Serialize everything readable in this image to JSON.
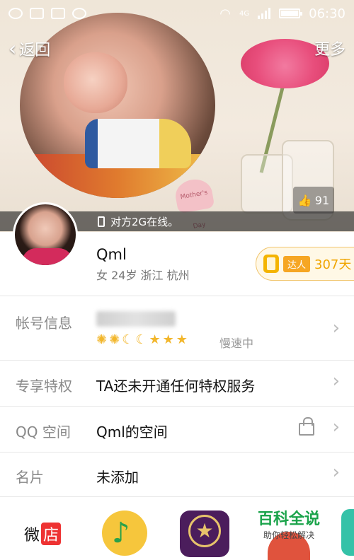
{
  "status_bar": {
    "network": "4G",
    "time": "06:30"
  },
  "nav": {
    "back_label": "返回",
    "more_label": "更多"
  },
  "cover": {
    "heart_tag_text": "Mother's Day",
    "like_count": "91",
    "online_text": "对方2G在线。"
  },
  "profile": {
    "name": "Qml",
    "details": "女 24岁 浙江 杭州",
    "badge_label": "达人",
    "badge_days": "307天"
  },
  "rows": {
    "account": {
      "label": "帐号信息",
      "speed": "慢速中",
      "level_icons": [
        "sun",
        "sun",
        "moon",
        "moon",
        "star",
        "star",
        "star"
      ]
    },
    "privilege": {
      "label": "专享特权",
      "value": "TA还未开通任何特权服务"
    },
    "qzone": {
      "label": "QQ 空间",
      "value": "Qml的空间"
    },
    "card": {
      "label": "名片",
      "value": "未添加"
    }
  },
  "bottom_apps": {
    "weidian_label": "微",
    "weidian_tag": "店"
  },
  "watermark": {
    "title": "百科全说",
    "subtitle": "助你轻松解决"
  },
  "colors": {
    "accent": "#f0a500",
    "online_bar": "#3a3a3a",
    "watermark_green": "#1aa34a"
  }
}
